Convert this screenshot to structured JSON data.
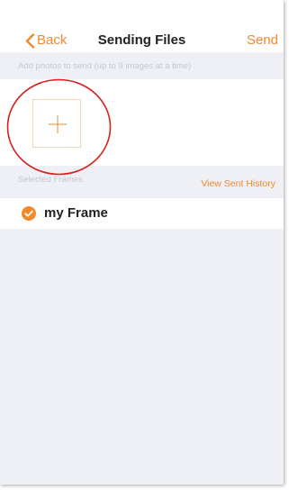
{
  "nav": {
    "back_label": "Back",
    "title": "Sending Files",
    "send_label": "Send"
  },
  "photos": {
    "hint": "Add photos to send (up to 9 images at a time)"
  },
  "frames": {
    "section_label": "Selected Frames",
    "history_link": "View Sent History",
    "items": [
      {
        "name": "my Frame",
        "selected": true
      }
    ]
  },
  "colors": {
    "accent": "#f08a2c",
    "annotation_circle": "#d82121",
    "background": "#eef0f6"
  },
  "icons": {
    "back": "chevron-left-icon",
    "add": "plus-icon",
    "selected": "checkmark-circle-icon"
  }
}
